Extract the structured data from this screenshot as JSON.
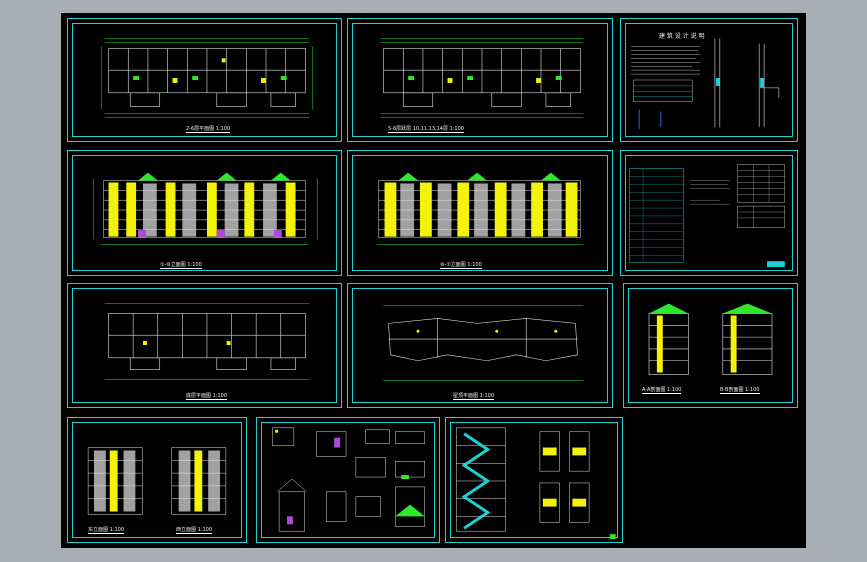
{
  "app": {
    "background_color": "#a8adb6",
    "viewport_color": "#000000",
    "frame_color": "#1fd0d0"
  },
  "sheets": {
    "s1": {
      "caption": "2-6层平面图 1:100"
    },
    "s2": {
      "caption": "5-6层跃层 10,11,13,14层 1:100"
    },
    "s3": {
      "title": "建 筑 设 计 说 明"
    },
    "s4": {
      "caption": "①-⑩立面图 1:100"
    },
    "s5": {
      "caption": "⑩-①立面图 1:100"
    },
    "s6": {
      "caption": ""
    },
    "s7": {
      "caption": "底层平面图 1:100"
    },
    "s8": {
      "caption": "屋顶平面图 1:100"
    },
    "s9": {
      "caption_left": "A-A剖面图 1:100",
      "caption_right": "B-B剖面图 1:100"
    },
    "s10": {
      "caption_left": "东立面图 1:100",
      "caption_right": "西立面图 1:100"
    },
    "s11": {
      "caption": ""
    },
    "s12": {
      "caption": ""
    }
  },
  "icons": [
    "floor-plan-icon",
    "elevation-icon",
    "section-icon",
    "detail-icon",
    "table-icon"
  ]
}
